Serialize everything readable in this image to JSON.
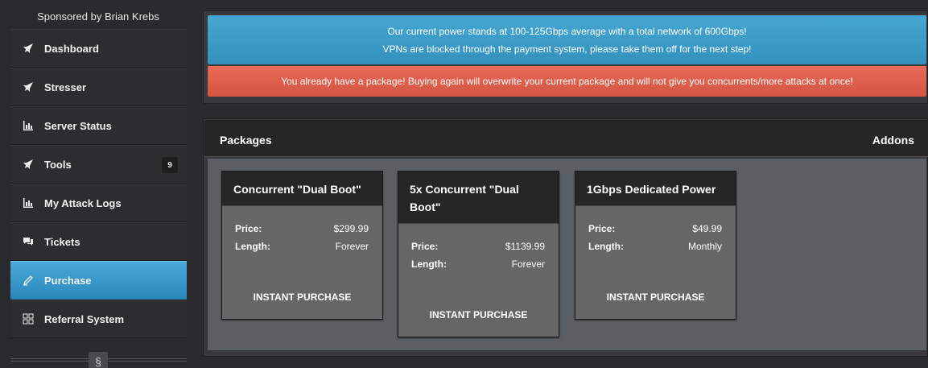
{
  "sidebar": {
    "sponsor": "Sponsored by Brian Krebs",
    "items": [
      {
        "label": "Dashboard",
        "icon": "rocket-icon"
      },
      {
        "label": "Stresser",
        "icon": "rocket-icon"
      },
      {
        "label": "Server Status",
        "icon": "bar-chart-icon"
      },
      {
        "label": "Tools",
        "icon": "rocket-icon",
        "badge": "9"
      },
      {
        "label": "My Attack Logs",
        "icon": "bar-chart-icon"
      },
      {
        "label": "Tickets",
        "icon": "chat-bubbles-icon"
      },
      {
        "label": "Purchase",
        "icon": "pencil-icon",
        "active": true
      },
      {
        "label": "Referral System",
        "icon": "grid-icon"
      }
    ],
    "collapse_glyph": "§"
  },
  "alerts": {
    "info_line1": "Our current power stands at 100-125Gbps average with a total network of 600Gbps!",
    "info_line2": "VPNs are blocked through the payment system, please take them off for the next step!",
    "danger": "You already have a package! Buying again will overwrite your current package and will not give you concurrents/more attacks at once!"
  },
  "packages": {
    "title": "Packages",
    "addons": "Addons",
    "cards": [
      {
        "name": "Concurrent \"Dual Boot\"",
        "price_label": "Price:",
        "price": "$299.99",
        "length_label": "Length:",
        "length": "Forever",
        "buy": "INSTANT PURCHASE"
      },
      {
        "name_line1": "5x Concurrent \"Dual",
        "name_line2": "Boot\"",
        "price_label": "Price:",
        "price": "$1139.99",
        "length_label": "Length:",
        "length": "Forever",
        "buy": "INSTANT PURCHASE"
      },
      {
        "name": "1Gbps Dedicated Power",
        "price_label": "Price:",
        "price": "$49.99",
        "length_label": "Length:",
        "length": "Monthly",
        "buy": "INSTANT PURCHASE"
      }
    ]
  },
  "colors": {
    "accent_blue": "#3a9ccb",
    "danger_red": "#e05f4d",
    "background": "#2b2b2d"
  }
}
